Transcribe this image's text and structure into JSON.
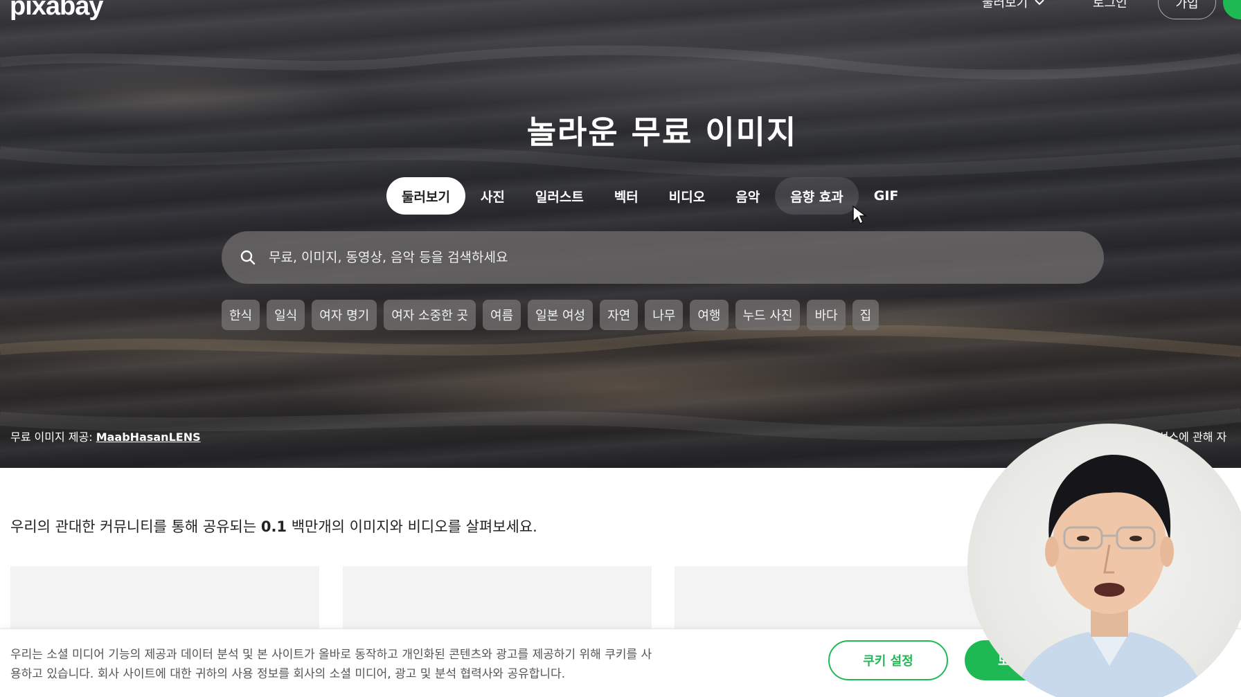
{
  "header": {
    "logo": "pixabay",
    "explore": "둘러보기",
    "login": "로그인",
    "join": "가입"
  },
  "hero": {
    "title": "놀라운 무료 이미지",
    "tabs": [
      {
        "label": "둘러보기",
        "active": true
      },
      {
        "label": "사진",
        "active": false
      },
      {
        "label": "일러스트",
        "active": false
      },
      {
        "label": "벡터",
        "active": false
      },
      {
        "label": "비디오",
        "active": false
      },
      {
        "label": "음악",
        "active": false
      },
      {
        "label": "음향 효과",
        "active": false
      },
      {
        "label": "GIF",
        "active": false
      }
    ],
    "search": {
      "placeholder": "무료, 이미지, 동영상, 음악 등을 검색하세요",
      "value": ""
    },
    "chips": [
      "한식",
      "일식",
      "여자 명기",
      "여자 소중한 곳",
      "여름",
      "일본 여성",
      "자연",
      "나무",
      "여행",
      "누드 사진",
      "바다",
      "집"
    ],
    "credit_label": "무료 이미지 제공:",
    "credit_author": "MaabHasanLENS",
    "license_link": "이선스",
    "license_suffix": "에 관해 자"
  },
  "content": {
    "community_prefix": "우리의 관대한 커뮤니티를 통해 공유되는 ",
    "community_count": "0.1",
    "community_suffix": " 백만개의 이미지와 비디오를 살펴보세요."
  },
  "cookie_banner": {
    "text_line1": "우리는 소셜 미디어 기능의 제공과 데이터 분석 및 본 사이트가 올바로 동작하고 개인화된 콘텐츠와 광고를 제공하기 위해 쿠키를 사",
    "text_line2": "용하고 있습니다. 회사 사이트에 대한 귀하의 사용 정보를 회사의 소셜 미디어, 광고 및 분석 협력사와 공유합니다.",
    "settings_button": "쿠키 설정",
    "accept_button": "모"
  },
  "colors": {
    "accent": "#1fb954",
    "hero_dark": "#2f3034"
  }
}
